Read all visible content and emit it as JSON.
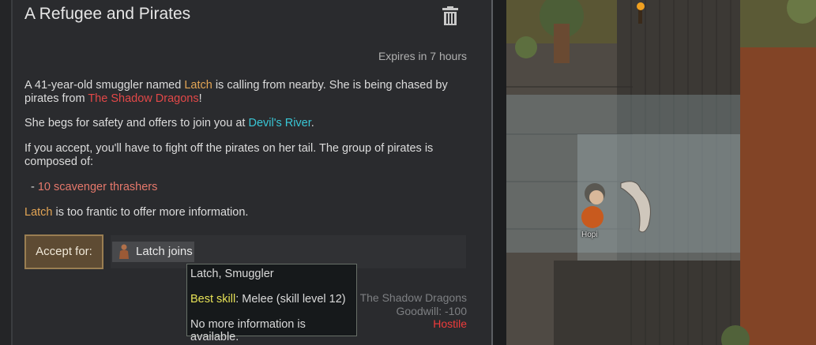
{
  "letter": {
    "title": "A Refugee and Pirates",
    "expires": "Expires in 7 hours",
    "p1_a": "A 41-year-old smuggler named ",
    "p1_name": "Latch",
    "p1_b": " is calling from nearby. She is being chased by pirates from ",
    "p1_faction": "The Shadow Dragons",
    "p1_c": "!",
    "p2_a": "She begs for safety and offers to join you at ",
    "p2_place": "Devil's River",
    "p2_b": ".",
    "p3": "If you accept, you'll have to fight off the pirates on her tail. The group of pirates is composed of:",
    "list_dash": "- ",
    "list_item": "10 scavenger thrashers",
    "p4_name": "Latch",
    "p4_rest": " is too frantic to offer more information.",
    "accept_label": "Accept for:",
    "joins_label": "Latch joins",
    "trash_icon": "trash-icon"
  },
  "faction": {
    "name": "The Shadow Dragons",
    "goodwill": "Goodwill: -100",
    "status": "Hostile"
  },
  "tooltip": {
    "name": "Latch",
    "role_text": ", Smuggler",
    "skill_label": "Best skill",
    "skill_value": ": Melee (skill level 12)",
    "note": "No more information is available."
  },
  "map": {
    "pawn_label": "Hopi"
  }
}
